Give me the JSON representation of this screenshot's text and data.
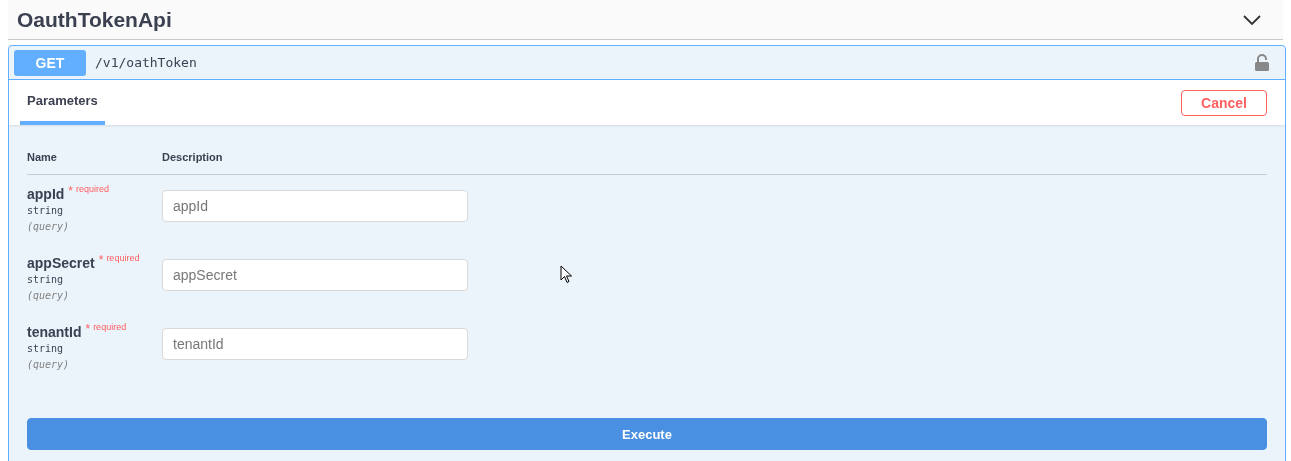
{
  "section": {
    "title": "OauthTokenApi"
  },
  "operation": {
    "method": "GET",
    "path": "/v1/oathToken"
  },
  "tabs": [
    {
      "label": "Parameters",
      "selected": true
    }
  ],
  "cancel_button": "Cancel",
  "columns": [
    "Name",
    "Description"
  ],
  "parameters": [
    {
      "name": "appId",
      "star": "*",
      "required": "required",
      "type": "string",
      "location": "(query)",
      "placeholder": "appId"
    },
    {
      "name": "appSecret",
      "star": "*",
      "required": "required",
      "type": "string",
      "location": "(query)",
      "placeholder": "appSecret"
    },
    {
      "name": "tenantId",
      "star": "*",
      "required": "required",
      "type": "string",
      "location": "(query)",
      "placeholder": "tenantId"
    }
  ],
  "execute_button": "Execute"
}
